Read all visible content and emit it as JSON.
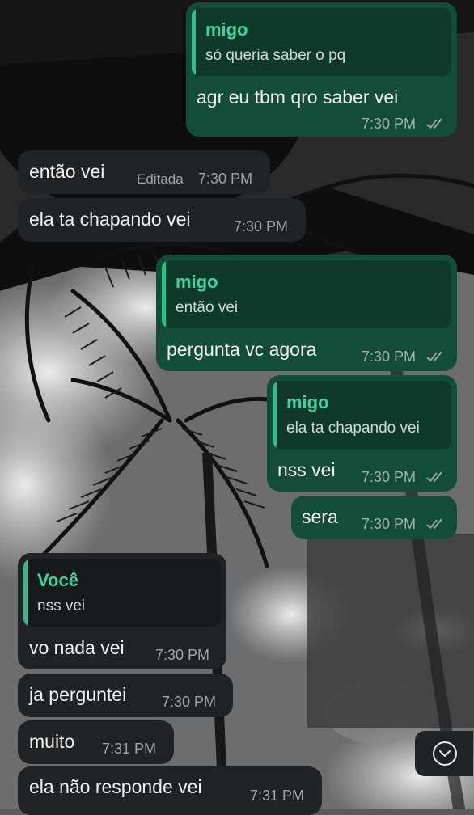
{
  "messages": [
    {
      "type": "outgoing",
      "quote": {
        "author": "migo",
        "text": "só queria saber o pq"
      },
      "text": "agr eu tbm qro saber vei",
      "time": "7:30 PM",
      "read": true
    },
    {
      "type": "incoming",
      "text": "então vei",
      "edited_label": "Editada",
      "time": "7:30 PM"
    },
    {
      "type": "incoming",
      "text": "ela ta chapando vei",
      "time": "7:30 PM"
    },
    {
      "type": "outgoing",
      "quote": {
        "author": "migo",
        "text": "então vei"
      },
      "text": "pergunta vc agora",
      "time": "7:30 PM",
      "read": true
    },
    {
      "type": "outgoing",
      "quote": {
        "author": "migo",
        "text": "ela ta chapando vei"
      },
      "text": "nss vei",
      "time": "7:30 PM",
      "read": true
    },
    {
      "type": "outgoing",
      "text": "sera",
      "time": "7:30 PM",
      "read": true
    },
    {
      "type": "incoming",
      "quote": {
        "author": "Você",
        "text": "nss vei"
      },
      "text": "vo nada vei",
      "time": "7:30 PM"
    },
    {
      "type": "incoming",
      "text": "ja perguntei",
      "time": "7:30 PM"
    },
    {
      "type": "incoming",
      "text": "muito",
      "time": "7:31 PM"
    },
    {
      "type": "incoming",
      "text": "ela não responde vei",
      "time": "7:31 PM"
    }
  ],
  "icons": {
    "read_receipt": "double-check-icon",
    "scroll_down": "chevron-down-circle-icon"
  },
  "colors": {
    "outgoing_bubble": "#134d37",
    "incoming_bubble": "#1f2326",
    "quote_accent": "#27c28c",
    "quote_author": "#3fd3a0"
  }
}
